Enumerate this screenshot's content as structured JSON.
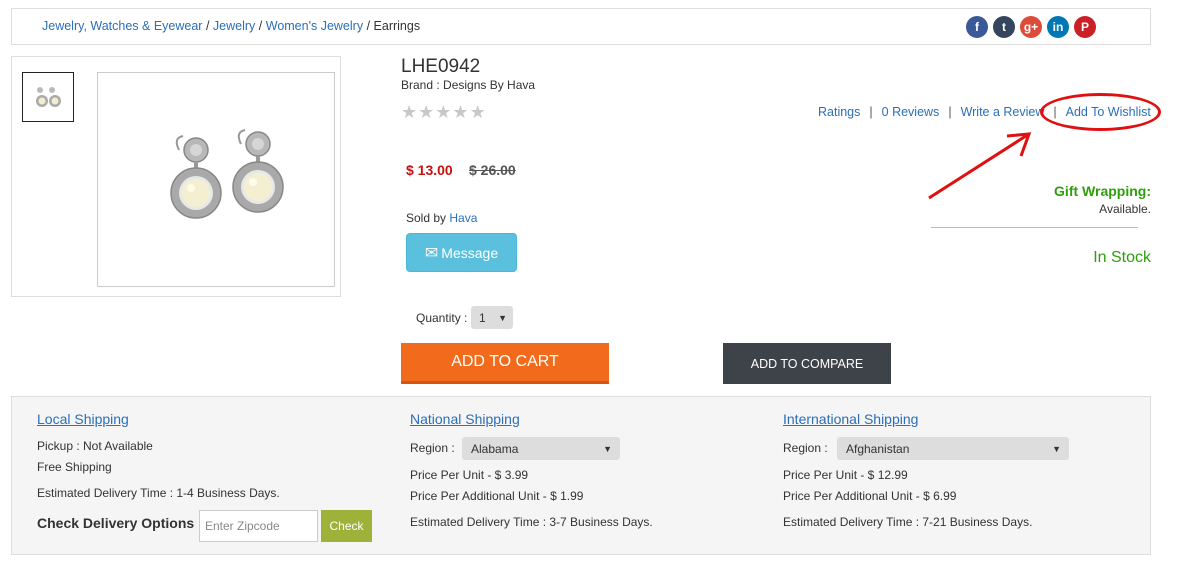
{
  "breadcrumb": {
    "items": [
      "Jewelry, Watches & Eyewear",
      "Jewelry",
      "Women's Jewelry"
    ],
    "separator": "/",
    "current": "Earrings"
  },
  "social": [
    {
      "icon": "facebook-icon",
      "glyph": "f",
      "color": "#3b5998"
    },
    {
      "icon": "tumblr-icon",
      "glyph": "t",
      "color": "#34465d"
    },
    {
      "icon": "google-plus-icon",
      "glyph": "g+",
      "color": "#dd4b39"
    },
    {
      "icon": "linkedin-icon",
      "glyph": "in",
      "color": "#0077b5"
    },
    {
      "icon": "pinterest-icon",
      "glyph": "P",
      "color": "#cb2027"
    }
  ],
  "product": {
    "title": "LHE0942",
    "brand": "Brand : Designs By Hava",
    "rating_stars": 5,
    "price": "$ 13.00",
    "old_price": "$ 26.00",
    "sold_by_label": "Sold by",
    "seller": "Hava",
    "message_label": "Message",
    "quantity_label": "Quantity :",
    "quantity_value": "1",
    "add_to_cart": "ADD TO CART",
    "add_to_compare": "ADD TO COMPARE"
  },
  "review_links": {
    "ratings": "Ratings",
    "reviews": "0 Reviews",
    "write_review": "Write a Review",
    "wishlist": "Add To Wishlist",
    "separator": "|"
  },
  "gift": {
    "label": "Gift Wrapping:",
    "value": "Available."
  },
  "stock_status": "In Stock",
  "colors": {
    "link": "#2a6fb8",
    "price": "#c8100f",
    "stock": "#2e9f0b",
    "cart": "#f26a1b",
    "compare": "#3e4249",
    "message": "#5bc0de",
    "check": "#9eb23a",
    "annotation": "#e01010"
  },
  "shipping": {
    "local": {
      "title": "Local Shipping",
      "pickup": "Pickup : Not Available",
      "free": "Free Shipping",
      "delivery": "Estimated Delivery Time : 1-4 Business Days.",
      "check_label": "Check Delivery Options",
      "zip_placeholder": "Enter Zipcode",
      "check_button": "Check"
    },
    "national": {
      "title": "National Shipping",
      "region_label": "Region :",
      "region_value": "Alabama",
      "price_per_unit": "Price Per Unit - $ 3.99",
      "price_additional": "Price Per Additional Unit - $ 1.99",
      "delivery": "Estimated Delivery Time : 3-7 Business Days."
    },
    "international": {
      "title": "International Shipping",
      "region_label": "Region :",
      "region_value": "Afghanistan",
      "price_per_unit": "Price Per Unit - $ 12.99",
      "price_additional": "Price Per Additional Unit - $ 6.99",
      "delivery": "Estimated Delivery Time : 7-21 Business Days."
    }
  }
}
